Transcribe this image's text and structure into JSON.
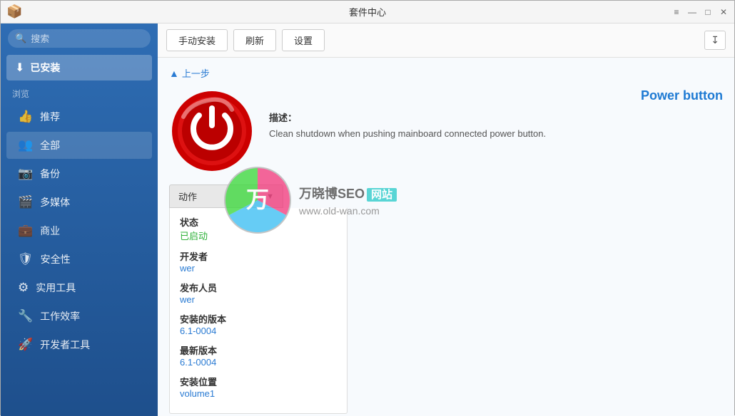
{
  "window": {
    "title": "套件中心",
    "icon": "📦"
  },
  "titlebar": {
    "controls": {
      "minimize": "—",
      "maximize": "□",
      "close": "✕",
      "menu": "≡"
    }
  },
  "sidebar": {
    "search_placeholder": "搜索",
    "installed": {
      "icon": "⬇",
      "label": "已安装"
    },
    "browse_label": "浏览",
    "items": [
      {
        "id": "recommend",
        "icon": "👍",
        "label": "推荐"
      },
      {
        "id": "all",
        "icon": "👥",
        "label": "全部"
      },
      {
        "id": "backup",
        "icon": "📷",
        "label": "备份"
      },
      {
        "id": "media",
        "icon": "🎬",
        "label": "多媒体"
      },
      {
        "id": "business",
        "icon": "💼",
        "label": "商业"
      },
      {
        "id": "security",
        "icon": "🛡",
        "label": "安全性"
      },
      {
        "id": "tools",
        "icon": "⚙",
        "label": "实用工具"
      },
      {
        "id": "efficiency",
        "icon": "🔧",
        "label": "工作效率"
      },
      {
        "id": "devtools",
        "icon": "🚀",
        "label": "开发者工具"
      }
    ]
  },
  "toolbar": {
    "btn_manual_install": "手动安装",
    "btn_refresh": "刷新",
    "btn_settings": "设置",
    "sort_icon": "↧"
  },
  "detail": {
    "back_label": "上一步",
    "pkg_title": "Power button",
    "desc_label": "描述：",
    "desc_text": "Clean shutdown when pushing mainboard connected power button.",
    "actions_label": "动作",
    "info": {
      "status_label": "状态",
      "status_value": "已启动",
      "developer_label": "开发者",
      "developer_value": "wer",
      "publisher_label": "发布人员",
      "publisher_value": "wer",
      "installed_version_label": "安装的版本",
      "installed_version_value": "6.1-0004",
      "latest_version_label": "最新版本",
      "latest_version_value": "6.1-0004",
      "install_location_label": "安装位置",
      "install_location_value": "volume1"
    }
  },
  "watermark": {
    "site_label": "万晓博SEO",
    "badge_label": "网站",
    "url": "www.old-wan.com",
    "circle_char": "万"
  }
}
